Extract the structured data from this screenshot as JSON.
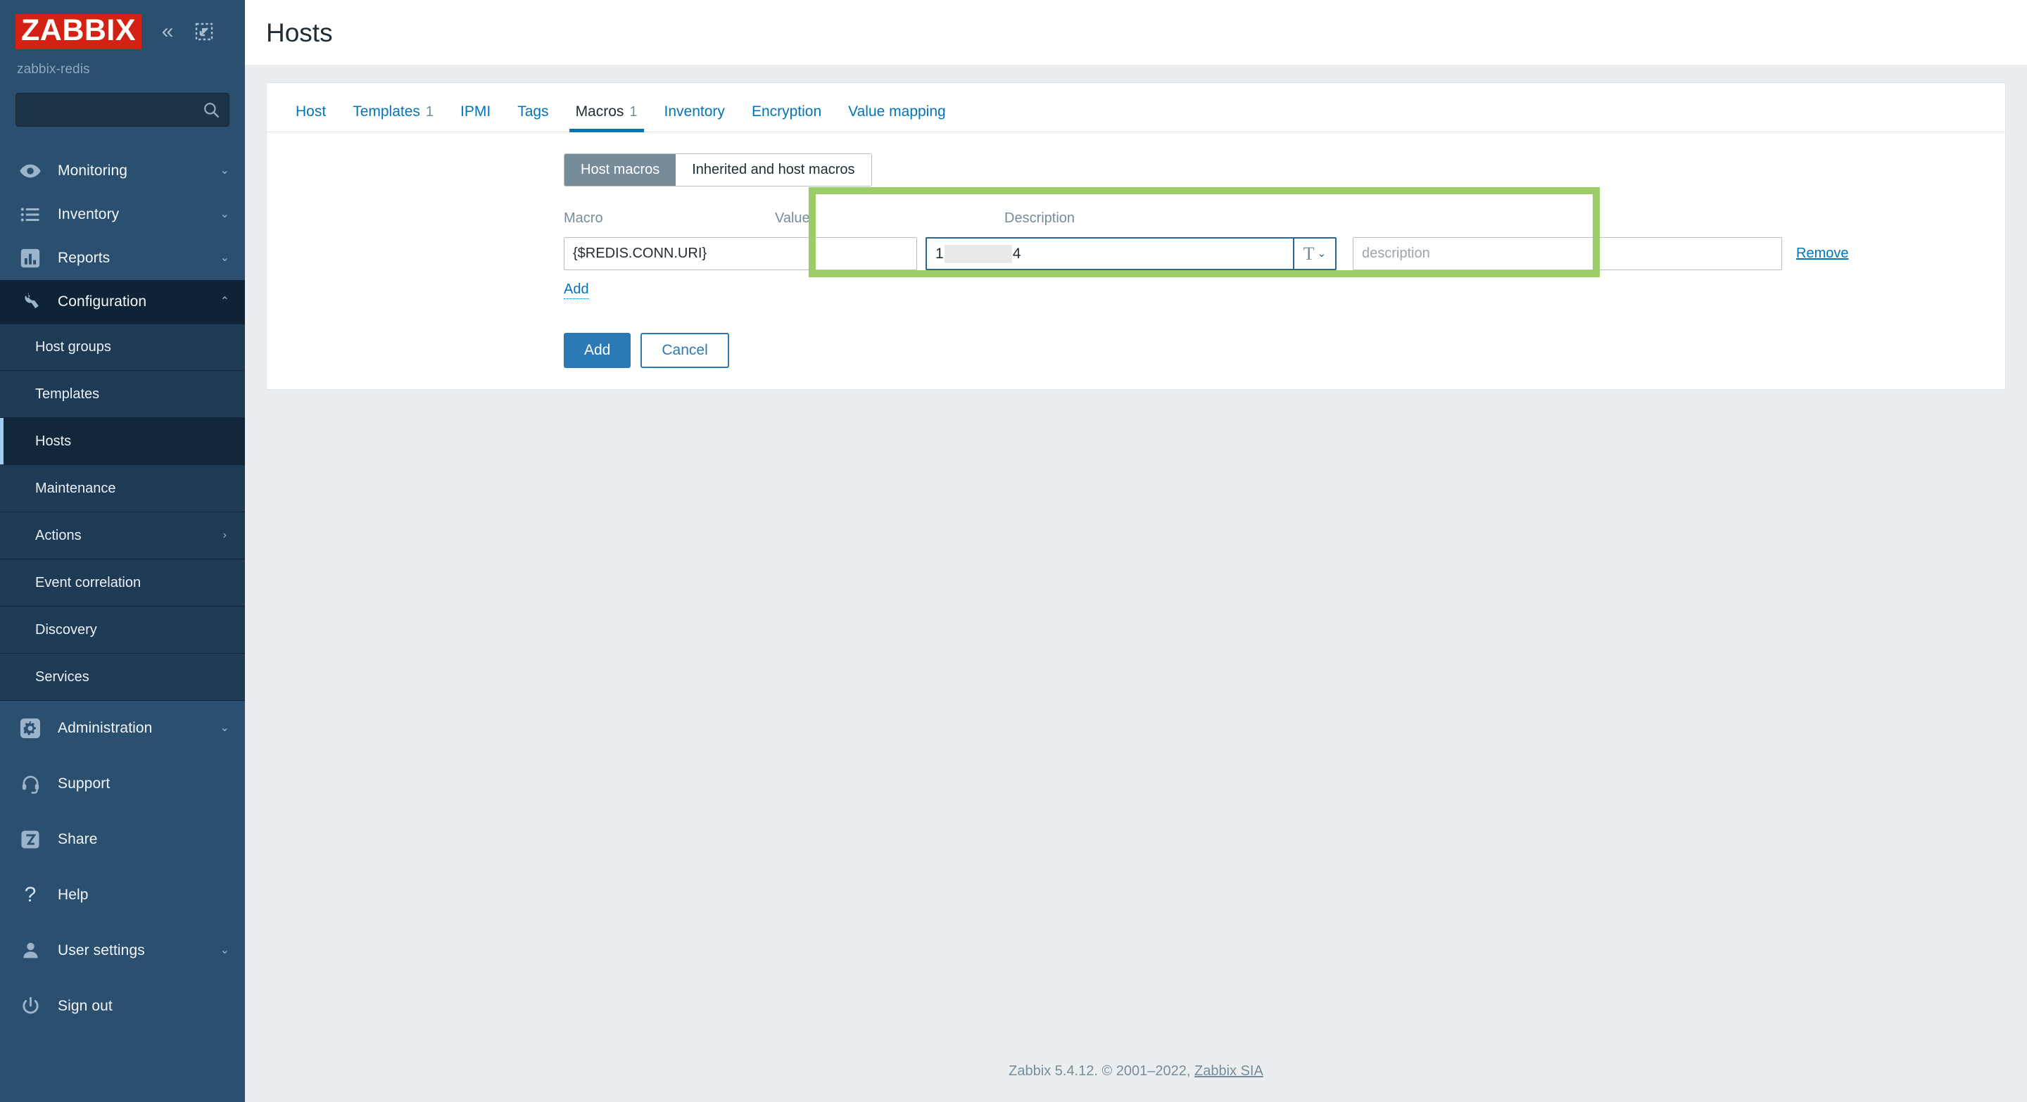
{
  "sidebar": {
    "logo_text": "ZABBIX",
    "collapse_icon": "double-chevron-left-icon",
    "hide_icon": "collapse-sidebar-icon",
    "host_name": "zabbix-redis",
    "search_placeholder": "",
    "search_value": "",
    "nav": [
      {
        "label": "Monitoring",
        "icon": "eye-icon",
        "arrow": "⌄"
      },
      {
        "label": "Inventory",
        "icon": "list-icon",
        "arrow": "⌄"
      },
      {
        "label": "Reports",
        "icon": "bar-chart-icon",
        "arrow": "⌄"
      },
      {
        "label": "Configuration",
        "icon": "wrench-icon",
        "arrow": "⌃"
      }
    ],
    "subnav": [
      {
        "label": "Host groups",
        "arrow": ""
      },
      {
        "label": "Templates",
        "arrow": ""
      },
      {
        "label": "Hosts",
        "arrow": ""
      },
      {
        "label": "Maintenance",
        "arrow": ""
      },
      {
        "label": "Actions",
        "arrow": "›"
      },
      {
        "label": "Event correlation",
        "arrow": ""
      },
      {
        "label": "Discovery",
        "arrow": ""
      },
      {
        "label": "Services",
        "arrow": ""
      }
    ],
    "admin": {
      "label": "Administration",
      "icon": "gear-icon",
      "arrow": "⌄"
    },
    "bottom": [
      {
        "label": "Support",
        "icon": "headset-icon",
        "arrow": ""
      },
      {
        "label": "Share",
        "icon": "zabbix-share-icon",
        "arrow": ""
      },
      {
        "label": "Help",
        "icon": "question-mark-icon",
        "arrow": ""
      },
      {
        "label": "User settings",
        "icon": "person-icon",
        "arrow": "⌄"
      },
      {
        "label": "Sign out",
        "icon": "power-icon",
        "arrow": ""
      }
    ]
  },
  "header": {
    "title": "Hosts"
  },
  "tabs": [
    {
      "label": "Host",
      "badge": ""
    },
    {
      "label": "Templates",
      "badge": "1"
    },
    {
      "label": "IPMI",
      "badge": ""
    },
    {
      "label": "Tags",
      "badge": ""
    },
    {
      "label": "Macros",
      "badge": "1"
    },
    {
      "label": "Inventory",
      "badge": ""
    },
    {
      "label": "Encryption",
      "badge": ""
    },
    {
      "label": "Value mapping",
      "badge": ""
    }
  ],
  "macros_form": {
    "segmented": {
      "host_macros_label": "Host macros",
      "inherited_label": "Inherited and host macros"
    },
    "columns": {
      "macro": "Macro",
      "value": "Value",
      "description": "Description"
    },
    "row": {
      "macro_value": "{$REDIS.CONN.URI}",
      "value_prefix": "1",
      "value_suffix": "4",
      "value_type_glyph": "T",
      "value_type_chevron": "⌄",
      "description_placeholder": "description",
      "remove_label": "Remove"
    },
    "add_link_label": "Add",
    "submit_label": "Add",
    "cancel_label": "Cancel",
    "highlight_color": "#9ccc65"
  },
  "footer": {
    "text": "Zabbix 5.4.12. © 2001–2022, ",
    "link": "Zabbix SIA"
  }
}
